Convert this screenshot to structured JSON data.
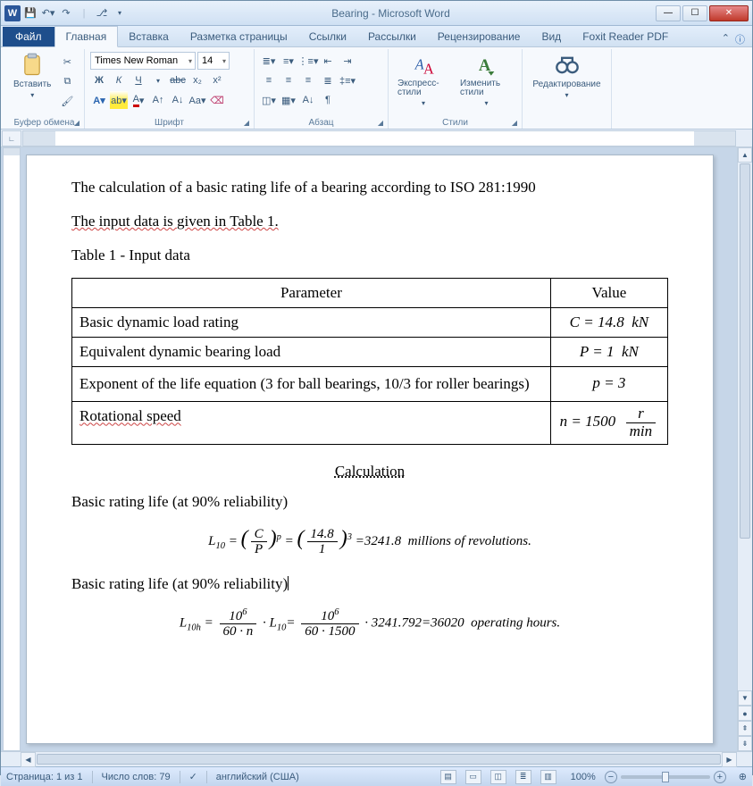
{
  "window": {
    "title": "Bearing  -  Microsoft Word"
  },
  "tabs": {
    "file": "Файл",
    "items": [
      "Главная",
      "Вставка",
      "Разметка страницы",
      "Ссылки",
      "Рассылки",
      "Рецензирование",
      "Вид",
      "Foxit Reader PDF"
    ]
  },
  "ribbon": {
    "clipboard": {
      "paste": "Вставить",
      "label": "Буфер обмена"
    },
    "font": {
      "name": "Times New Roman",
      "size": "14",
      "label": "Шрифт"
    },
    "paragraph": {
      "label": "Абзац"
    },
    "styles": {
      "express": "Экспресс-стили",
      "change": "Изменить стили",
      "label": "Стили"
    },
    "editing": {
      "label": "Редактирование"
    }
  },
  "doc": {
    "p1": "The calculation of a basic rating life of a bearing according to ISO 281:1990",
    "p2": "The input data is given in Table 1.",
    "p3": "Table 1 - Input data",
    "th1": "Parameter",
    "th2": "Value",
    "r1p": "Basic dynamic load rating",
    "r1v": "C = 14.8 kN",
    "r2p": "Equivalent dynamic bearing load",
    "r2v": "P = 1  kN",
    "r3p": "Exponent of the life equation (3 for ball bearings, 10/3 for roller bearings)",
    "r3v": "p = 3",
    "r4p": "Rotational speed",
    "calc": "Calculation",
    "brl": "Basic rating life (at 90% reliability)",
    "f1_res": "3241.8",
    "f1_tail": "millions of revolutions.",
    "f2_res": "36020",
    "f2_tail": "operating hours."
  },
  "status": {
    "page": "Страница: 1 из 1",
    "words": "Число слов: 79",
    "lang": "английский (США)",
    "zoom": "100%"
  }
}
